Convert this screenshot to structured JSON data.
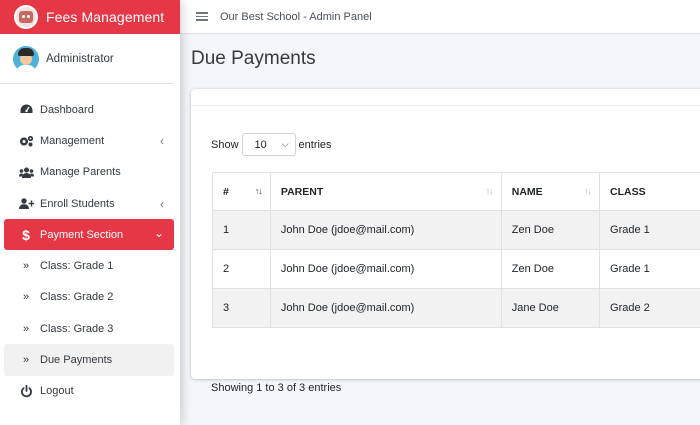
{
  "brand": {
    "title": "Fees Management"
  },
  "user": {
    "name": "Administrator"
  },
  "topbar": {
    "title": "Our Best School - Admin Panel"
  },
  "sidebar": {
    "items": [
      {
        "label": "Dashboard",
        "icon": "dashboard-icon"
      },
      {
        "label": "Management",
        "icon": "cogs-icon",
        "chevron": "‹"
      },
      {
        "label": "Manage Parents",
        "icon": "users-icon"
      },
      {
        "label": "Enroll Students",
        "icon": "user-plus-icon",
        "chevron": "‹"
      },
      {
        "label": "Payment Section",
        "icon": "dollar-icon",
        "chevron": "⌄"
      },
      {
        "label": "Class: Grade 1",
        "icon": "double-chevron-icon"
      },
      {
        "label": "Class: Grade 2",
        "icon": "double-chevron-icon"
      },
      {
        "label": "Class: Grade 3",
        "icon": "double-chevron-icon"
      },
      {
        "label": "Due Payments",
        "icon": "double-chevron-icon"
      },
      {
        "label": "Logout",
        "icon": "power-icon"
      }
    ]
  },
  "page": {
    "title": "Due Payments"
  },
  "table_controls": {
    "show_label": "Show",
    "entries_value": "10",
    "entries_label": "entries",
    "info": "Showing 1 to 3 of 3 entries"
  },
  "table": {
    "columns": [
      "#",
      "PARENT",
      "NAME",
      "CLASS"
    ],
    "rows": [
      [
        "1",
        "John Doe (jdoe@mail.com)",
        "Zen Doe",
        "Grade 1"
      ],
      [
        "2",
        "John Doe (jdoe@mail.com)",
        "Zen Doe",
        "Grade 1"
      ],
      [
        "3",
        "John Doe (jdoe@mail.com)",
        "Jane Doe",
        "Grade 2"
      ]
    ]
  },
  "colors": {
    "accent": "#e63746",
    "background": "#f4f6f9"
  }
}
